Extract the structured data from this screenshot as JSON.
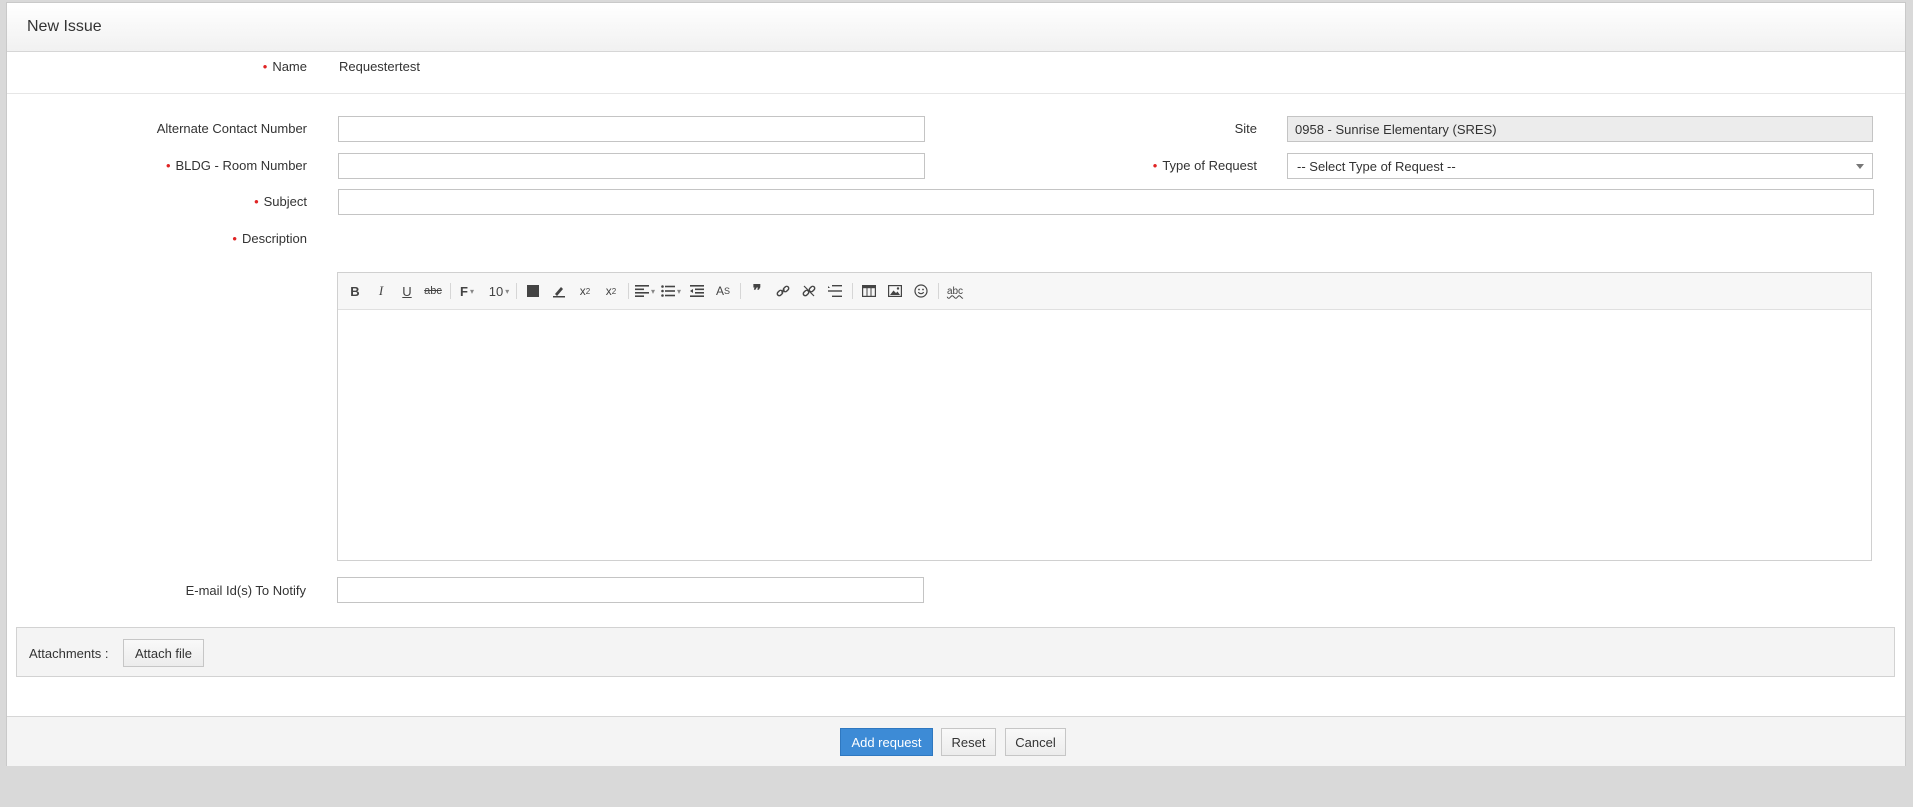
{
  "header": {
    "title": "New Issue"
  },
  "form": {
    "name": {
      "label": "Name",
      "value": "Requestertest"
    },
    "alt_contact": {
      "label": "Alternate Contact Number",
      "value": ""
    },
    "site": {
      "label": "Site",
      "value": "0958 - Sunrise Elementary (SRES)"
    },
    "bldg_room": {
      "label": "BLDG - Room Number",
      "value": ""
    },
    "type_of_request": {
      "label": "Type of Request",
      "selected": "-- Select Type of Request --"
    },
    "subject": {
      "label": "Subject",
      "value": ""
    },
    "description": {
      "label": "Description",
      "font_size": "10",
      "body": ""
    },
    "email_notify": {
      "label": "E-mail Id(s) To Notify",
      "value": ""
    },
    "required_mark": "•"
  },
  "editor_toolbar": [
    "bold-icon",
    "italic-icon",
    "underline-icon",
    "strikethrough-icon",
    "font-family-icon",
    "font-size-select",
    "text-color-icon",
    "highlight-icon",
    "subscript-icon",
    "superscript-icon",
    "align-icon",
    "list-icon",
    "outdent-icon",
    "clear-format-icon",
    "quote-icon",
    "link-icon",
    "unlink-icon",
    "horizontal-line-icon",
    "table-icon",
    "image-icon",
    "emoji-icon",
    "spellcheck-icon"
  ],
  "attachments": {
    "label": "Attachments :",
    "button": "Attach file"
  },
  "footer": {
    "add": "Add request",
    "reset": "Reset",
    "cancel": "Cancel"
  },
  "colors": {
    "primary": "#3d8bd6",
    "required": "#e02424",
    "page_bg": "#d9d9d9"
  }
}
